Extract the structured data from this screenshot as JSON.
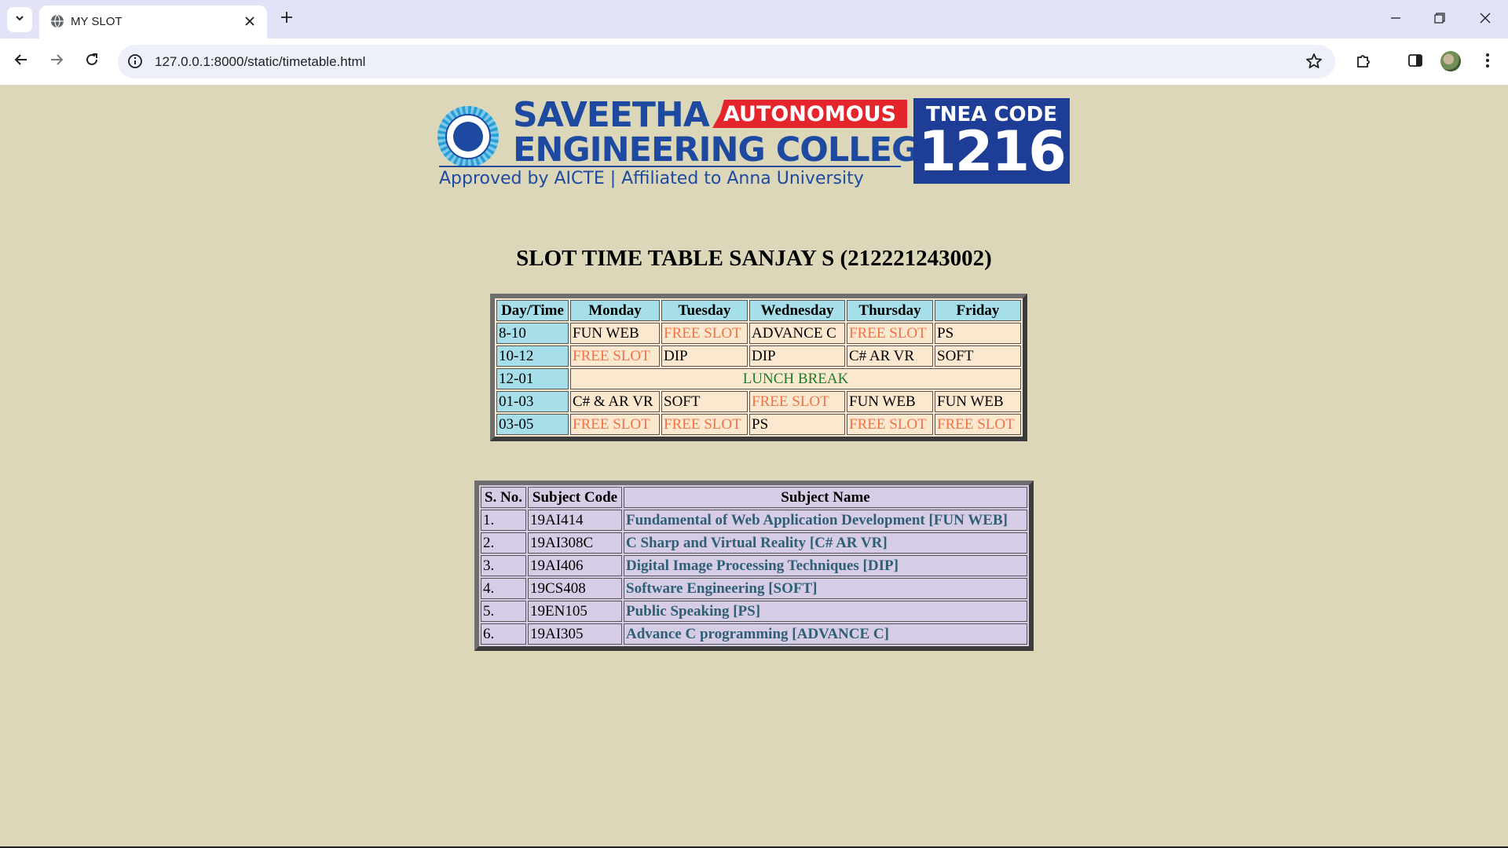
{
  "browser": {
    "tab_title": "MY SLOT",
    "url": "127.0.0.1:8000/static/timetable.html"
  },
  "banner": {
    "college_line1": "SAVEETHA",
    "college_line2": "ENGINEERING COLLEGE",
    "autonomous": "AUTONOMOUS",
    "approved": "Approved by AICTE  |  Affiliated to Anna University",
    "tnea_label": "TNEA CODE",
    "tnea_code": "1216"
  },
  "page_title": "SLOT TIME TABLE SANJAY S (212221243002)",
  "timetable": {
    "headers": [
      "Day/Time",
      "Monday",
      "Tuesday",
      "Wednesday",
      "Thursday",
      "Friday"
    ],
    "rows": [
      {
        "time": "8-10",
        "cells": [
          "FUN WEB",
          "FREE SLOT",
          "ADVANCE C",
          "FREE SLOT",
          "PS"
        ]
      },
      {
        "time": "10-12",
        "cells": [
          "FREE SLOT",
          "DIP",
          "DIP",
          "C# AR VR",
          "SOFT"
        ]
      },
      {
        "time": "12-01",
        "lunch": "LUNCH BREAK"
      },
      {
        "time": "01-03",
        "cells": [
          "C# & AR VR",
          "SOFT",
          "FREE SLOT",
          "FUN WEB",
          "FUN WEB"
        ]
      },
      {
        "time": "03-05",
        "cells": [
          "FREE SLOT",
          "FREE SLOT",
          "PS",
          "FREE SLOT",
          "FREE SLOT"
        ]
      }
    ],
    "colors": {
      "free": "#f07348",
      "lunch": "#1f7a2a",
      "header_bg": "#a6dfe9",
      "cell_bg": "#fbe8cf"
    }
  },
  "subjects": {
    "headers": [
      "S. No.",
      "Subject Code",
      "Subject Name"
    ],
    "rows": [
      {
        "no": "1.",
        "code": "19AI414",
        "name": "Fundamental of Web Application Development [FUN WEB]"
      },
      {
        "no": "2.",
        "code": "19AI308C",
        "name": "C Sharp and Virtual Reality [C# AR VR]"
      },
      {
        "no": "3.",
        "code": "19AI406",
        "name": "Digital Image Processing Techniques [DIP]"
      },
      {
        "no": "4.",
        "code": "19CS408",
        "name": "Software Engineering [SOFT]"
      },
      {
        "no": "5.",
        "code": "19EN105",
        "name": "Public Speaking [PS]"
      },
      {
        "no": "6.",
        "code": "19AI305",
        "name": "Advance C programming [ADVANCE C]"
      }
    ]
  }
}
